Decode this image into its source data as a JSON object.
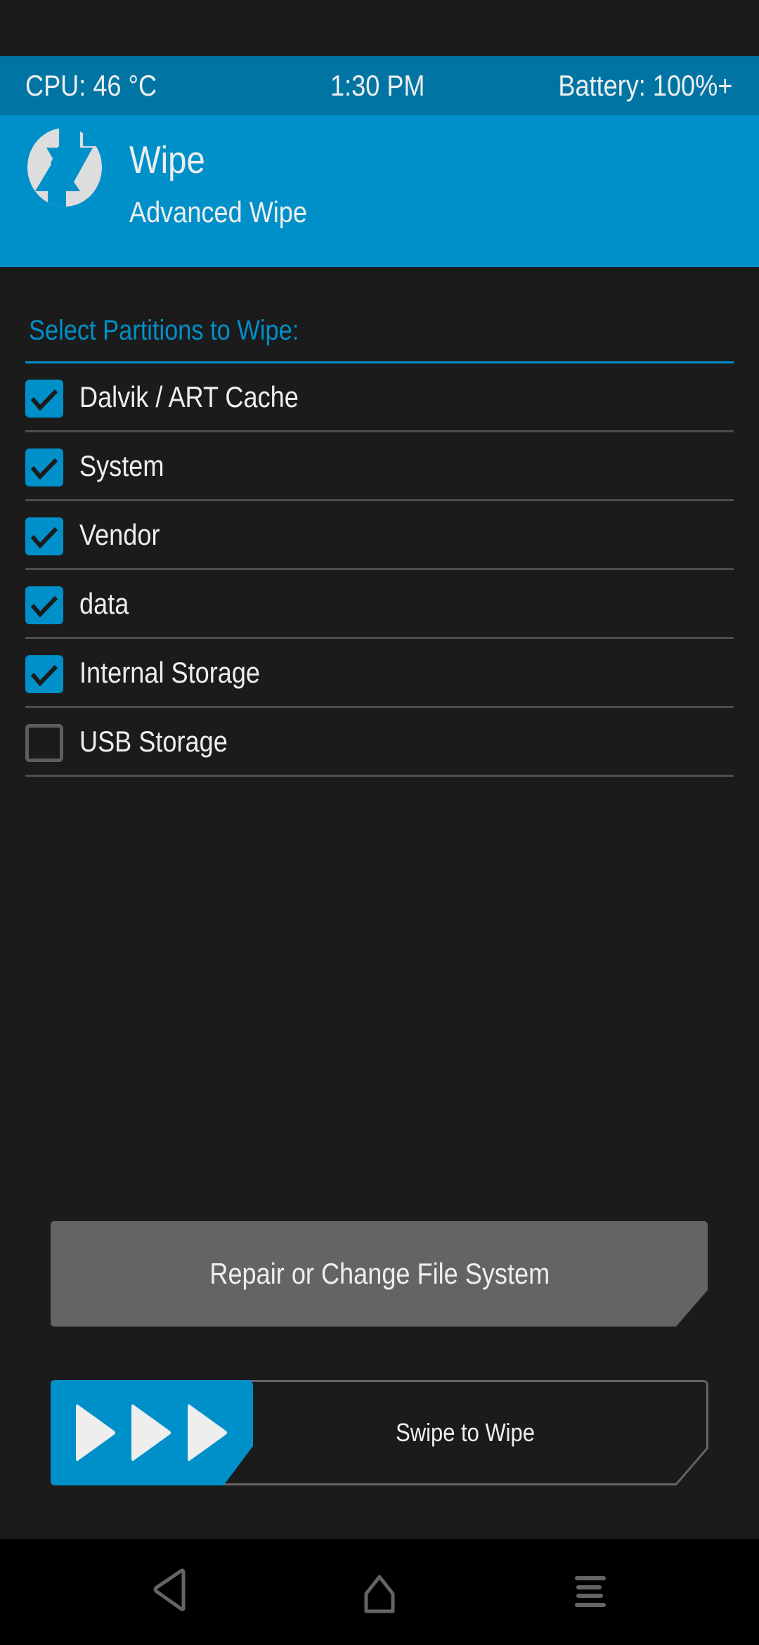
{
  "status_bar": {
    "cpu_temp": "CPU: 46 °C",
    "time": "1:30 PM",
    "battery": "Battery: 100%+"
  },
  "header": {
    "logo_icon": "twrp-logo-icon",
    "title": "Wipe",
    "subtitle": "Advanced Wipe"
  },
  "section": {
    "title": "Select Partitions to Wipe:"
  },
  "partitions": [
    {
      "label": "Dalvik / ART Cache",
      "checked": true
    },
    {
      "label": "System",
      "checked": true
    },
    {
      "label": "Vendor",
      "checked": true
    },
    {
      "label": "data",
      "checked": true
    },
    {
      "label": "Internal Storage",
      "checked": true
    },
    {
      "label": "USB Storage",
      "checked": false
    }
  ],
  "buttons": {
    "repair_label": "Repair or Change File System",
    "swipe_label": "Swipe to Wipe",
    "swipe_icon": "triple-chevron-right-icon"
  },
  "nav_bar": {
    "back_icon": "back-icon",
    "home_icon": "home-icon",
    "menu_icon": "menu-icon"
  },
  "colors": {
    "accent": "#0090c9",
    "status_bar_bg": "#0075a4",
    "background": "#1b1b1b",
    "button_gray": "#646464",
    "divider": "#4d4d4d",
    "text": "#eeeeee"
  }
}
